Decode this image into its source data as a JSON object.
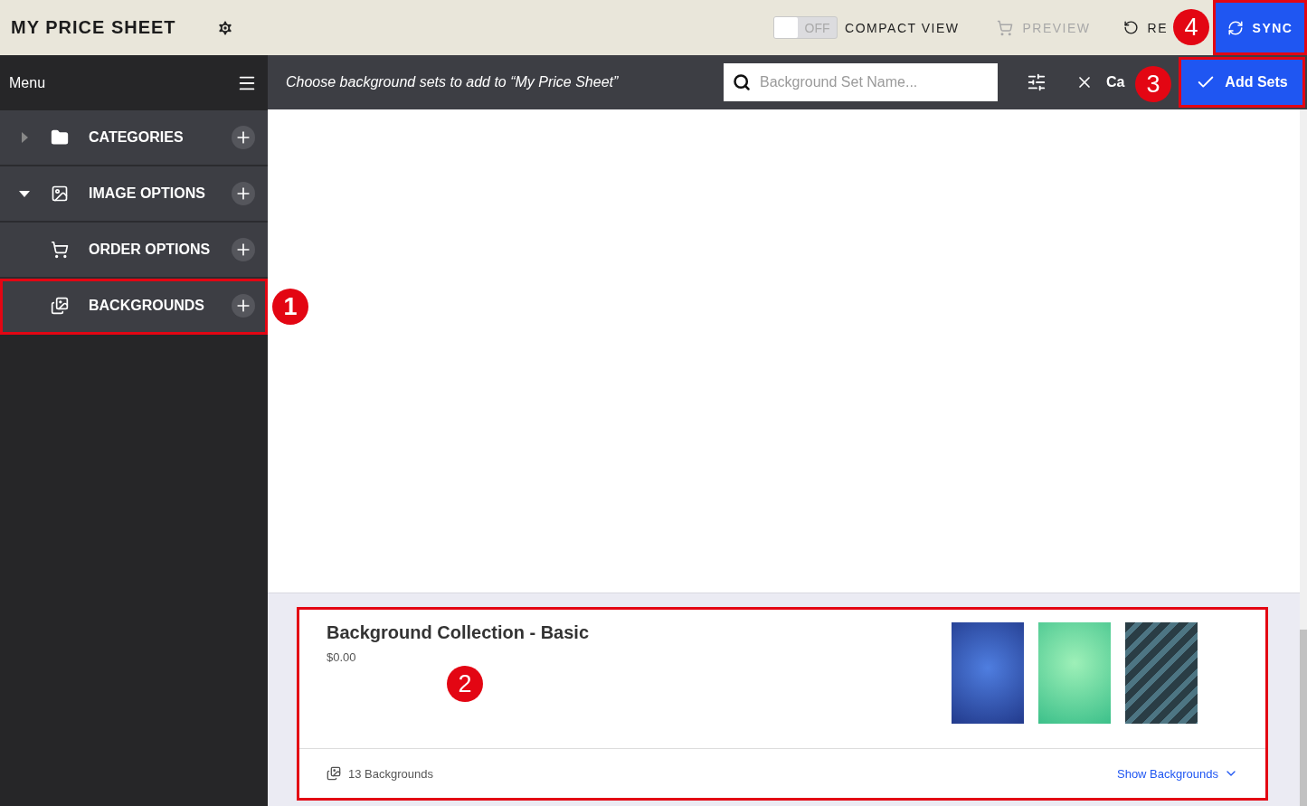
{
  "topbar": {
    "title": "MY PRICE SHEET",
    "compact_toggle": {
      "label": "OFF",
      "on": false
    },
    "compact_label": "COMPACT VIEW",
    "preview": {
      "label": "PREVIEW",
      "disabled": true
    },
    "revert": {
      "label": "RE"
    },
    "sync": {
      "label": "SYNC",
      "callout": "4"
    }
  },
  "sidebar": {
    "title": "Menu",
    "items": [
      {
        "label": "CATEGORIES",
        "expanded": false
      },
      {
        "label": "IMAGE OPTIONS",
        "expanded": true
      },
      {
        "label": "ORDER OPTIONS"
      },
      {
        "label": "BACKGROUNDS",
        "callout": "1"
      }
    ]
  },
  "subheader": {
    "prompt": "Choose background sets to add to “My Price Sheet”",
    "search": {
      "placeholder": "Background Set Name..."
    },
    "cancel": {
      "label": "Ca"
    },
    "add": {
      "label": "Add Sets",
      "callout": "3"
    }
  },
  "card": {
    "title": "Background Collection - Basic",
    "price": "$0.00",
    "count": "13 Backgrounds",
    "show": "Show Backgrounds",
    "callout": "2"
  }
}
